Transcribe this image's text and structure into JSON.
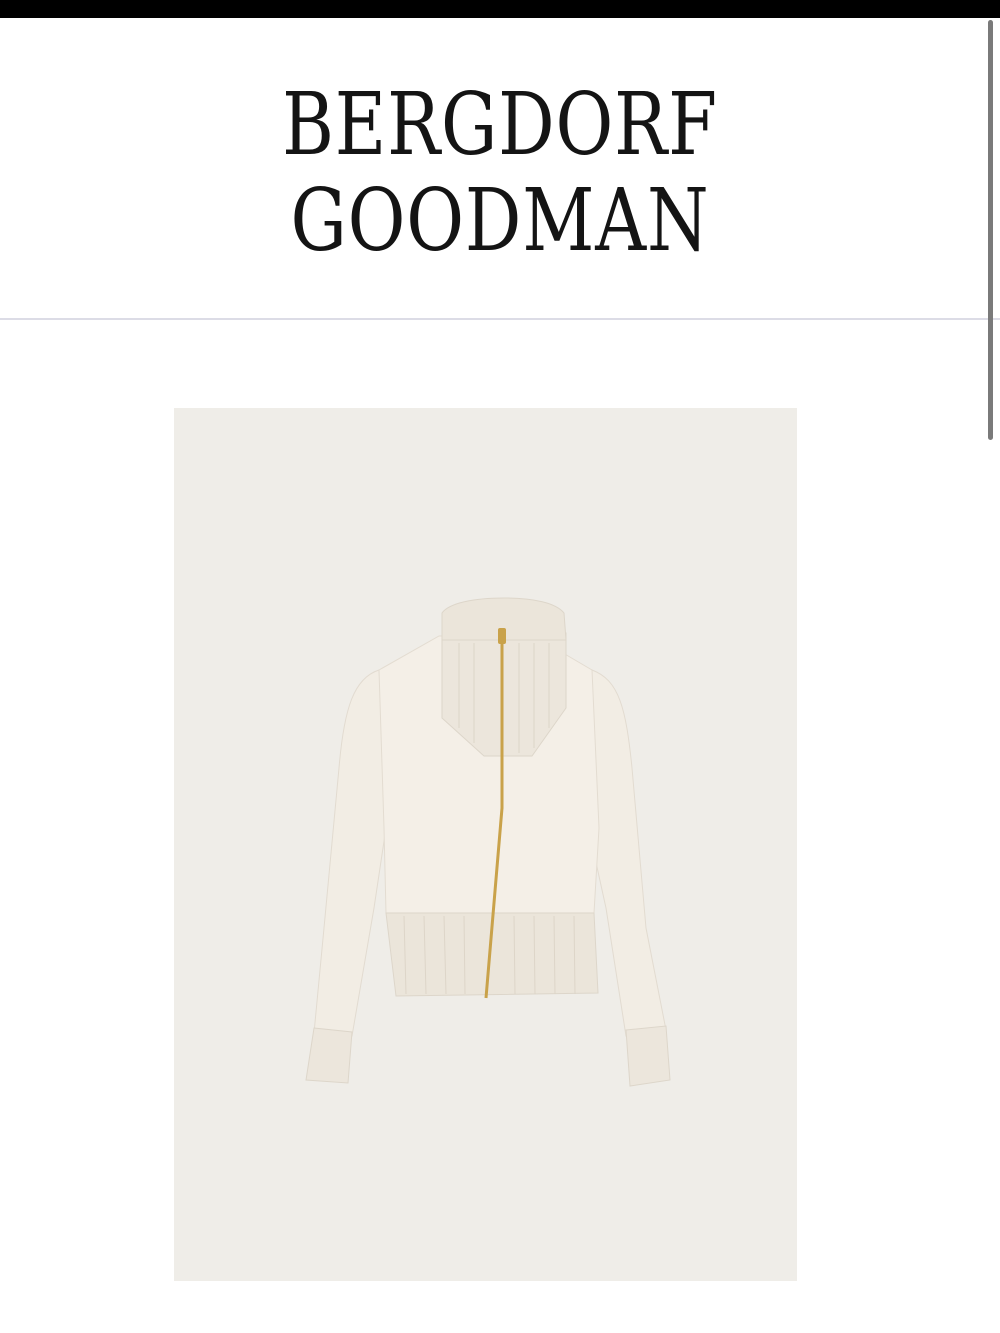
{
  "brand": {
    "line1": "BERGDORF",
    "line2": "GOODMAN"
  },
  "product": {
    "image_icon": "jacket-product-image",
    "background_color": "#efede8",
    "garment_color": "#f3eee6",
    "zipper_color": "#c9a24a"
  }
}
